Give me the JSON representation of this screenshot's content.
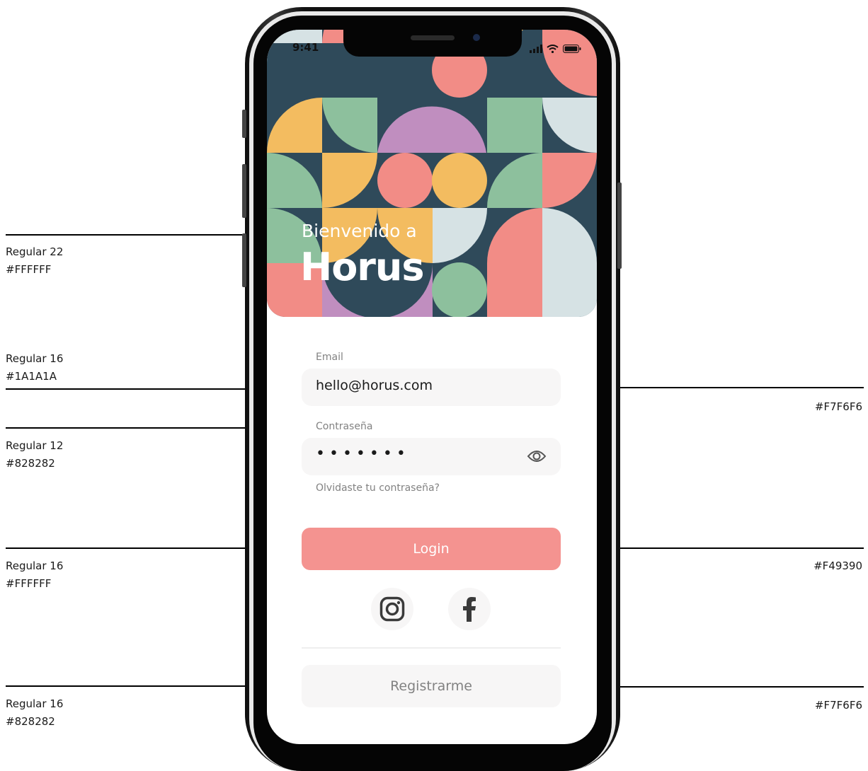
{
  "status_bar": {
    "time": "9:41"
  },
  "hero": {
    "welcome": "Bienvenido a",
    "brand": "Horus"
  },
  "form": {
    "email_label": "Email",
    "email_value": "hello@horus.com",
    "password_label": "Contraseña",
    "password_mask": "•••••••",
    "forgot": "Olvidaste tu contraseña?",
    "login": "Login",
    "register": "Registrarme"
  },
  "annotations": {
    "left": [
      {
        "style": "Regular 22",
        "color": "#FFFFFF"
      },
      {
        "style": "Regular 16",
        "color": "#1A1A1A"
      },
      {
        "style": "Regular 12",
        "color": "#828282"
      },
      {
        "style": "Regular 16",
        "color": "#FFFFFF"
      },
      {
        "style": "Regular 16",
        "color": "#828282"
      }
    ],
    "right": [
      {
        "color": "#F7F6F6"
      },
      {
        "color": "#F49390"
      },
      {
        "color": "#F7F6F6"
      }
    ]
  },
  "icons": [
    "signal-icon",
    "wifi-icon",
    "battery-icon",
    "eye-icon",
    "instagram-icon",
    "facebook-icon"
  ],
  "colors": {
    "field_bg": "#F7F6F6",
    "accent": "#F49390",
    "text_dark": "#1A1A1A",
    "text_muted": "#828282",
    "pattern_navy": "#2F4A5A",
    "pattern_coral": "#F28C86",
    "pattern_yellow": "#F3BC60",
    "pattern_green": "#8DC09D",
    "pattern_purple": "#C08EBF",
    "pattern_pale": "#D6E2E4"
  }
}
